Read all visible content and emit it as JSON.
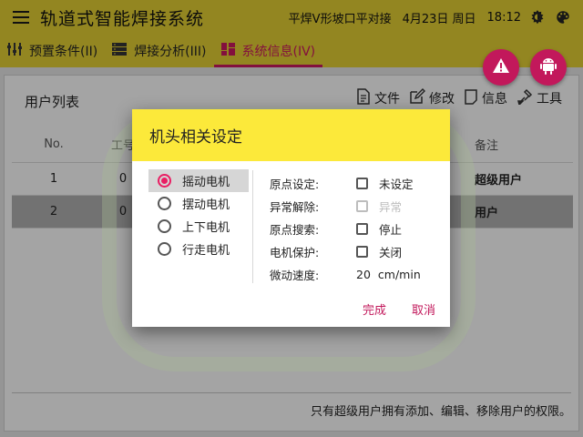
{
  "appbar": {
    "title": "轨道式智能焊接系统",
    "weld_mode": "平焊V形坡口平对接",
    "date": "4月23日 周日",
    "time": "18:12",
    "icons": [
      "menu-icon",
      "brightness-icon",
      "palette-icon"
    ]
  },
  "tabs": [
    {
      "label": "预置条件(II)",
      "icon": "sliders-icon",
      "active": false
    },
    {
      "label": "焊接分析(III)",
      "icon": "server-icon",
      "active": false
    },
    {
      "label": "系统信息(IV)",
      "icon": "dashboard-icon",
      "active": true
    }
  ],
  "fabs": [
    {
      "icon": "warning-icon"
    },
    {
      "icon": "android-icon"
    }
  ],
  "card": {
    "title": "用户列表",
    "toolbar": [
      {
        "label": "文件",
        "icon": "file-icon"
      },
      {
        "label": "修改",
        "icon": "edit-icon"
      },
      {
        "label": "信息",
        "icon": "info-icon"
      },
      {
        "label": "工具",
        "icon": "tools-icon"
      }
    ],
    "columns": {
      "no": "No.",
      "id": "工号",
      "note": "备注"
    },
    "rows": [
      {
        "no": "1",
        "id": "0",
        "note": "超级用户",
        "selected": false
      },
      {
        "no": "2",
        "id": "0",
        "note": "用户",
        "selected": true
      }
    ],
    "footer": "只有超级用户拥有添加、编辑、移除用户的权限。"
  },
  "dialog": {
    "title": "机头相关设定",
    "motors": [
      {
        "label": "摇动电机",
        "selected": true
      },
      {
        "label": "摆动电机",
        "selected": false
      },
      {
        "label": "上下电机",
        "selected": false
      },
      {
        "label": "行走电机",
        "selected": false
      }
    ],
    "settings": [
      {
        "label": "原点设定:",
        "value": "未设定",
        "disabled": false
      },
      {
        "label": "异常解除:",
        "value": "异常",
        "disabled": true
      },
      {
        "label": "原点搜索:",
        "value": "停止",
        "disabled": false
      },
      {
        "label": "电机保护:",
        "value": "关闭",
        "disabled": false
      }
    ],
    "speed": {
      "label": "微动速度:",
      "value": "20",
      "unit": "cm/min"
    },
    "confirm_label": "完成",
    "cancel_label": "取消"
  },
  "colors": {
    "appbar": "#d9c631",
    "accent": "#c2185b",
    "dialog_header": "#fce93a"
  }
}
